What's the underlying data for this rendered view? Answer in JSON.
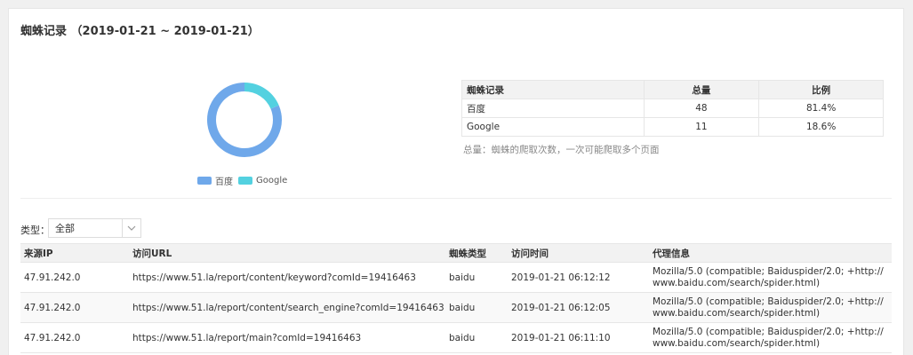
{
  "title": "蜘蛛记录 （2019-01-21 ~ 2019-01-21）",
  "chart_data": {
    "type": "pie",
    "categories": [
      "百度",
      "Google"
    ],
    "values": [
      48,
      11
    ],
    "colors": [
      "#6fa8ea",
      "#53d1e0"
    ],
    "legend_position": "bottom"
  },
  "summary": {
    "headers": [
      "蜘蛛记录",
      "总量",
      "比例"
    ],
    "rows": [
      [
        "百度",
        "48",
        "81.4%"
      ],
      [
        "Google",
        "11",
        "18.6%"
      ]
    ],
    "note": "总量：蜘蛛的爬取次数，一次可能爬取多个页面"
  },
  "filter": {
    "label": "类型：",
    "selected": "全部"
  },
  "records": {
    "headers": [
      "来源IP",
      "访问URL",
      "蜘蛛类型",
      "访问时间",
      "代理信息"
    ],
    "rows": [
      [
        "47.91.242.0",
        "https://www.51.la/report/content/keyword?comId=19416463",
        "baidu",
        "2019-01-21 06:12:12",
        "Mozilla/5.0 (compatible; Baiduspider/2.0; +http://www.baidu.com/search/spider.html)"
      ],
      [
        "47.91.242.0",
        "https://www.51.la/report/content/search_engine?comId=19416463",
        "baidu",
        "2019-01-21 06:12:05",
        "Mozilla/5.0 (compatible; Baiduspider/2.0; +http://www.baidu.com/search/spider.html)"
      ],
      [
        "47.91.242.0",
        "https://www.51.la/report/main?comId=19416463",
        "baidu",
        "2019-01-21 06:11:10",
        "Mozilla/5.0 (compatible; Baiduspider/2.0; +http://www.baidu.com/search/spider.html)"
      ]
    ]
  }
}
